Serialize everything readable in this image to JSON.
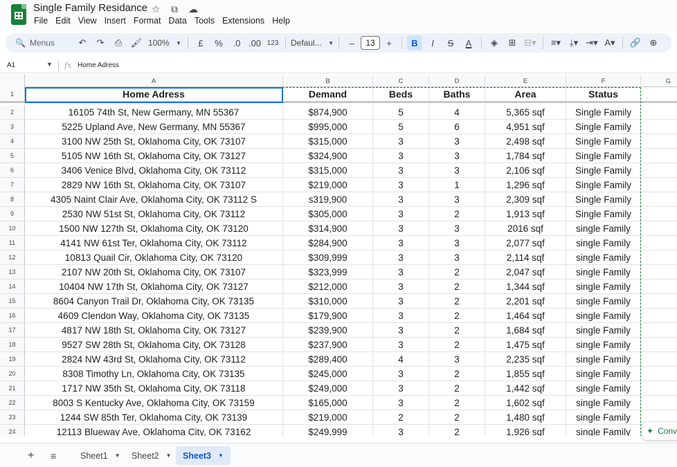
{
  "app": {
    "title": "Single Family Residance",
    "title_icons": [
      "star-icon",
      "move-to-folder-icon",
      "cloud-saved-icon"
    ],
    "menus": [
      "File",
      "Edit",
      "View",
      "Insert",
      "Format",
      "Data",
      "Tools",
      "Extensions",
      "Help"
    ]
  },
  "toolbar": {
    "search_label": "Menus",
    "zoom": "100%",
    "currency": "£",
    "percent": "%",
    "decimal_decrease": ".0",
    "decimal_increase": ".00",
    "number_format": "123",
    "font": "Defaul...",
    "font_size": "13",
    "minus": "–",
    "plus": "+",
    "bold": "B",
    "italic": "I",
    "strike": "S",
    "text_color": "A"
  },
  "formula": {
    "cell_ref": "A1",
    "fx": "fx",
    "value": "Home Adress"
  },
  "grid": {
    "column_letters": [
      "A",
      "B",
      "C",
      "D",
      "E",
      "F",
      "G"
    ],
    "headers": [
      "Home Adress",
      "Demand",
      "Beds",
      "Baths",
      "Area",
      "Status"
    ],
    "rows": [
      [
        "16105 74th St, New Germany, MN 55367",
        "$874,900",
        "5",
        "4",
        "5,365 sqf",
        "Single Family"
      ],
      [
        "5225 Upland Ave, New Germany, MN 55367",
        "$995,000",
        "5",
        "6",
        "4,951 sqf",
        "Single Family"
      ],
      [
        "3100 NW 25th St, Oklahoma City, OK 73107",
        "$315,000",
        "3",
        "3",
        "2,498 sqf",
        "Single Family"
      ],
      [
        "5105 NW 16th St, Oklahoma City, OK 73127",
        "$324,900",
        "3",
        "3",
        "1,784 sqf",
        "Single Family"
      ],
      [
        "3406 Venice Blvd, Oklahoma City, OK 73112",
        "$315,000",
        "3",
        "3",
        "2,106 sqf",
        "Single Family"
      ],
      [
        "2829 NW 16th St, Oklahoma City, OK 73107",
        "$219,000",
        "3",
        "1",
        "1,296 sqf",
        "Single Family"
      ],
      [
        "4305 Naint Clair Ave, Oklahoma City, OK 73112 S",
        "s319,900",
        "3",
        "3",
        "2,309 sqf",
        "Single Family"
      ],
      [
        "2530 NW 51st St, Oklahoma City, OK 73112",
        "$305,000",
        "3",
        "2",
        "1,913 sqf",
        "Single Family"
      ],
      [
        "1500 NW 127th St, Oklahoma City, OK 73120",
        "$314,900",
        "3",
        "3",
        "2016 sqf",
        "single Family"
      ],
      [
        "4141 NW 61st Ter, Oklahoma City, OK 73112",
        "$284,900",
        "3",
        "3",
        "2,077 sqf",
        "single Family"
      ],
      [
        "10813 Quail Cir, Oklahoma City, OK 73120",
        "$309,999",
        "3",
        "3",
        "2,114 sqf",
        "single Family"
      ],
      [
        "2107 NW 20th St, Oklahoma City, OK 73107",
        "$323,999",
        "3",
        "2",
        "2,047 sqf",
        "single Family"
      ],
      [
        "10404 NW 17th St, Oklahoma City, OK 73127",
        "$212,000",
        "3",
        "2",
        "1,344 sqf",
        "single Family"
      ],
      [
        "8604 Canyon Trail Dr, Oklahoma City, OK 73135",
        "$310,000",
        "3",
        "2",
        "2,201 sqf",
        "single Family"
      ],
      [
        "4609 Clendon Way, Oklahoma City, OK 73135",
        "$179,900",
        "3",
        "2",
        "1,464 sqf",
        "single Family"
      ],
      [
        "4817 NW 18th St, Oklahoma City, OK 73127",
        "$239,900",
        "3",
        "2",
        "1,684 sqf",
        "single Family"
      ],
      [
        "9527 SW 28th St, Oklahoma City, OK 73128",
        "$237,900",
        "3",
        "2",
        "1,475 sqf",
        "single Family"
      ],
      [
        "2824 NW 43rd St, Oklahoma City, OK 73112",
        "$289,400",
        "4",
        "3",
        "2,235 sqf",
        "single Family"
      ],
      [
        "8308 Timothy Ln, Oklahoma City, OK 73135",
        "$245,000",
        "3",
        "2",
        "1,855 sqf",
        "single Family"
      ],
      [
        "1717 NW 35th St, Oklahoma City, OK 73118",
        "$249,000",
        "3",
        "2",
        "1,442 sqf",
        "single Family"
      ],
      [
        "8003 S Kentucky Ave, Oklahoma City, OK 73159",
        "$165,000",
        "3",
        "2",
        "1,602 sqf",
        "single Family"
      ],
      [
        "1244 SW 85th Ter, Oklahoma City, OK 73139",
        "$219,000",
        "2",
        "2",
        "1,480 sqf",
        "single Family"
      ],
      [
        "12113 Blueway Ave, Oklahoma City, OK 73162",
        "$249,999",
        "3",
        "2",
        "1,926 sqf",
        "single Family"
      ]
    ]
  },
  "convert_chip": "Conv",
  "sheets": [
    "Sheet1",
    "Sheet2",
    "Sheet3"
  ],
  "active_sheet": "Sheet3",
  "colors": {
    "accent": "#0b57d0",
    "logo": "#188038",
    "selection": "#1a73e8"
  }
}
